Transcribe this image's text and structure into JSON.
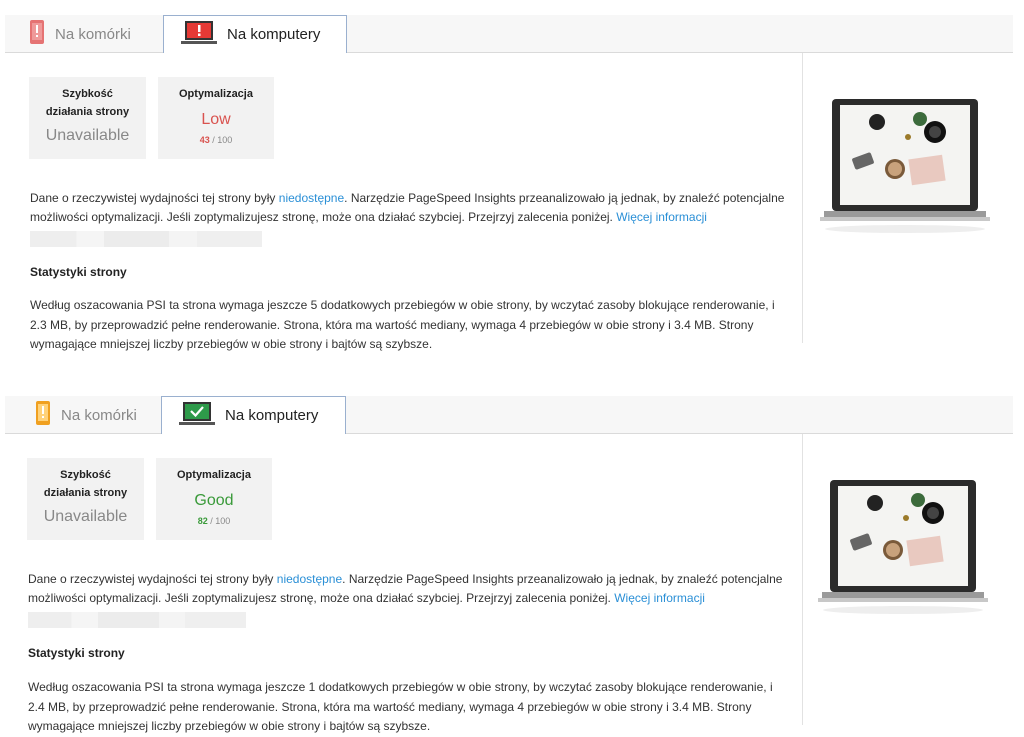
{
  "panels": [
    {
      "tabs": {
        "mobile_label": "Na komórki",
        "desktop_label": "Na komputery"
      },
      "speed_card": {
        "title_line1": "Szybkość",
        "title_line2": "działania strony",
        "value": "Unavailable"
      },
      "opt_card": {
        "title": "Optymalizacja",
        "value": "Low",
        "score": "43",
        "score_suffix": " / 100",
        "color": "#d9534f"
      },
      "description": {
        "part1": "Dane o rzeczywistej wydajności tej strony były ",
        "link1": "niedostępne",
        "part2": ". Narzędzie PageSpeed Insights przeanalizowało ją jednak, by znaleźć potencjalne możliwości optymalizacji. Jeśli zoptymalizujesz stronę, może ona działać szybciej. Przejrzyj zalecenia poniżej. ",
        "link2": "Więcej informacji"
      },
      "stats_heading": "Statystyki strony",
      "stats_text": "Według oszacowania PSI ta strona wymaga jeszcze 5 dodatkowych przebiegów w obie strony, by wczytać zasoby blokujące renderowanie, i 2.3 MB, by przeprowadzić pełne renderowanie. Strona, która ma wartość mediany, wymaga 4 przebiegów w obie strony i 3.4 MB. Strony wymagające mniejszej liczby przebiegów w obie strony i bajtów są szybsze.",
      "mobile_icon": "phone-warning-icon",
      "desktop_icon": "laptop-warning-icon"
    },
    {
      "tabs": {
        "mobile_label": "Na komórki",
        "desktop_label": "Na komputery"
      },
      "speed_card": {
        "title_line1": "Szybkość",
        "title_line2": "działania strony",
        "value": "Unavailable"
      },
      "opt_card": {
        "title": "Optymalizacja",
        "value": "Good",
        "score": "82",
        "score_suffix": " / 100",
        "color": "#3a9a3a"
      },
      "description": {
        "part1": "Dane o rzeczywistej wydajności tej strony były ",
        "link1": "niedostępne",
        "part2": ". Narzędzie PageSpeed Insights przeanalizowało ją jednak, by znaleźć potencjalne możliwości optymalizacji. Jeśli zoptymalizujesz stronę, może ona działać szybciej. Przejrzyj zalecenia poniżej. ",
        "link2": "Więcej informacji"
      },
      "stats_heading": "Statystyki strony",
      "stats_text": "Według oszacowania PSI ta strona wymaga jeszcze 1 dodatkowych przebiegów w obie strony, by wczytać zasoby blokujące renderowanie, i 2.4 MB, by przeprowadzić pełne renderowanie. Strona, która ma wartość mediany, wymaga 4 przebiegów w obie strony i 3.4 MB. Strony wymagające mniejszej liczby przebiegów w obie strony i bajtów są szybsze.",
      "mobile_icon": "phone-caution-icon",
      "desktop_icon": "laptop-check-icon"
    }
  ]
}
